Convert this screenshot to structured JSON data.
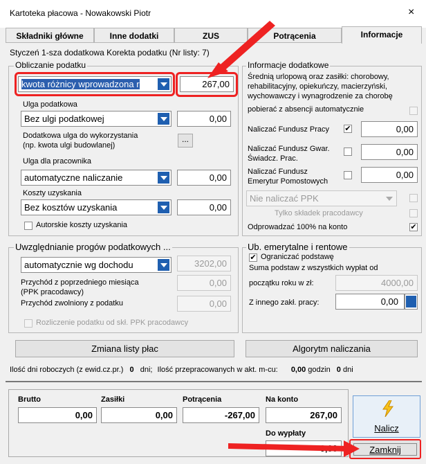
{
  "window": {
    "title": "Kartoteka płacowa - Nowakowski Piotr",
    "close": "×"
  },
  "tabs": [
    "Składniki główne",
    "Inne dodatki",
    "ZUS",
    "Potrącenia",
    "Informacje"
  ],
  "header_info": "Styczeń 1-sza dodatkowa Korekta podatku (Nr listy: 7)",
  "tax": {
    "legend": "Obliczanie podatku",
    "method_value": "kwota różnicy wprowadzona r",
    "method_amount": "267,00",
    "relief_label": "Ulga podatkowa",
    "relief_value": "Bez ulgi podatkowej",
    "relief_amount": "0,00",
    "extra_relief_label": "Dodatkowa ulga do wykorzystania\n(np. kwota ulgi budowlanej)",
    "extra_relief_button": "...",
    "employee_relief_label": "Ulga dla pracownika",
    "employee_relief_value": "automatyczne naliczanie",
    "employee_relief_amount": "0,00",
    "costs_label": "Koszty uzyskania",
    "costs_value": "Bez kosztów uzyskania",
    "costs_amount": "0,00",
    "author_costs_label": "Autorskie koszty uzyskania"
  },
  "thresholds": {
    "legend": "Uwzględnianie progów podatkowych ...",
    "mode_value": "automatycznie wg dochodu",
    "mode_amount": "3202,00",
    "prev_income_label": "Przychód z poprzedniego miesiąca\n(PPK pracodawcy)",
    "prev_income_amount": "0,00",
    "exempt_label": "Przychód zwolniony z podatku",
    "exempt_amount": "0,00",
    "ppk_settlement_label": "Rozliczenie podatku od skł. PPK pracodawcy"
  },
  "additional": {
    "legend": "Informacje dodatkowe",
    "sick_text": "Średnią urlopową oraz zasiłki: chorobowy,\nrehabilitacyjny, opiekuńczy, macierzyński,\nwychowawczy i wynagrodzenie za chorobę",
    "sick_auto_label": "pobierać z absencji automatycznie",
    "fp_label": "Naliczać Fundusz Pracy",
    "fp_checked": "✔",
    "fp_amount": "0,00",
    "fgsp_label": "Naliczać Fundusz Gwar.\nŚwiadcz. Prac.",
    "fgsp_amount": "0,00",
    "fep_label": "Naliczać Fundusz\nEmerytur Pomostowych",
    "fep_amount": "0,00",
    "ppk_value": "Nie naliczać PPK",
    "employer_only_label": "Tylko składek pracodawcy",
    "transfer_label": "Odprowadzać 100% na konto",
    "transfer_checked": "✔"
  },
  "pension": {
    "legend": "Ub. emerytalne i rentowe",
    "limit_label": "Ograniczać podstawę",
    "limit_checked": "✔",
    "sum_text": "Suma podstaw z wszystkich wypłat od",
    "ytd_label": "początku roku w zł:",
    "ytd_amount": "4000,00",
    "other_label": "Z innego zakł. pracy:",
    "other_amount": "0,00"
  },
  "buttons": {
    "change_list": "Zmiana listy płac",
    "algorithm": "Algorytm naliczania",
    "calculate": "Nalicz",
    "close": "Zamknij"
  },
  "status": {
    "work_days_label": "Ilość dni roboczych (z ewid.cz.pr.)",
    "work_days_value": "0",
    "days_unit": "dni;",
    "worked_label": "Ilość przepracowanych w akt. m-cu:",
    "worked_hours": "0,00",
    "hours_unit": "godzin",
    "worked_days": "0",
    "days_unit2": "dni"
  },
  "totals": {
    "gross_label": "Brutto",
    "gross": "0,00",
    "benefits_label": "Zasiłki",
    "benefits": "0,00",
    "deductions_label": "Potrącenia",
    "deductions": "-267,00",
    "account_label": "Na konto",
    "account": "267,00",
    "payout_label": "Do wypłaty",
    "payout": "0,00"
  },
  "colors": {
    "arrow": "#ee2222",
    "highlight": "#2c5fae",
    "combo_arrow": "#1f5fb0"
  }
}
